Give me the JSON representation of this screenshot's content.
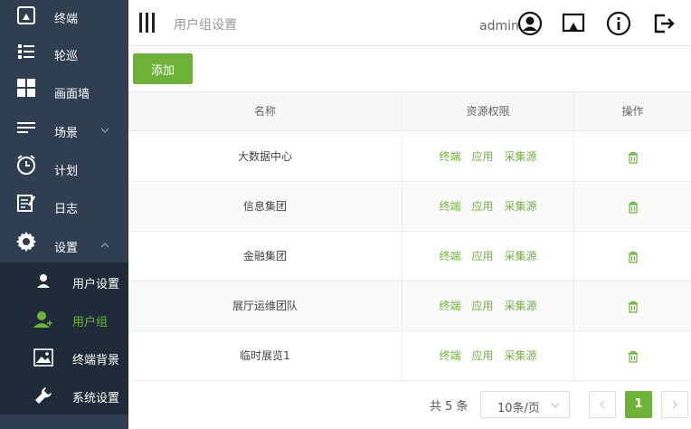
{
  "sidebar": {
    "items": [
      {
        "label": "终端",
        "icon": "terminal-icon"
      },
      {
        "label": "轮巡",
        "icon": "list-icon"
      },
      {
        "label": "画面墙",
        "icon": "grid-icon"
      },
      {
        "label": "场景",
        "icon": "scene-icon"
      },
      {
        "label": "计划",
        "icon": "clock-icon"
      },
      {
        "label": "日志",
        "icon": "log-icon"
      },
      {
        "label": "设置",
        "icon": "gear-icon"
      }
    ],
    "submenu": [
      {
        "label": "用户设置",
        "icon": "user-icon"
      },
      {
        "label": "用户组",
        "icon": "user-group-icon",
        "active": true
      },
      {
        "label": "终端背景",
        "icon": "image-icon"
      },
      {
        "label": "系统设置",
        "icon": "wrench-icon"
      }
    ]
  },
  "header": {
    "title": "用户组设置",
    "username": "admin"
  },
  "toolbar": {
    "add_label": "添加"
  },
  "table": {
    "columns": [
      "名称",
      "资源权限",
      "操作"
    ],
    "permission_links": [
      "终端",
      "应用",
      "采集源"
    ],
    "rows": [
      {
        "name": "大数据中心"
      },
      {
        "name": "信息集团"
      },
      {
        "name": "金融集团"
      },
      {
        "name": "展厅运维团队"
      },
      {
        "name": "临时展览1"
      }
    ]
  },
  "pagination": {
    "total_text": "共 5 条",
    "page_size": "10条/页",
    "current_page": "1"
  },
  "colors": {
    "accent": "#6fb23a",
    "sidebar_bg": "#2f3e50",
    "submenu_bg": "#1f2b38"
  }
}
